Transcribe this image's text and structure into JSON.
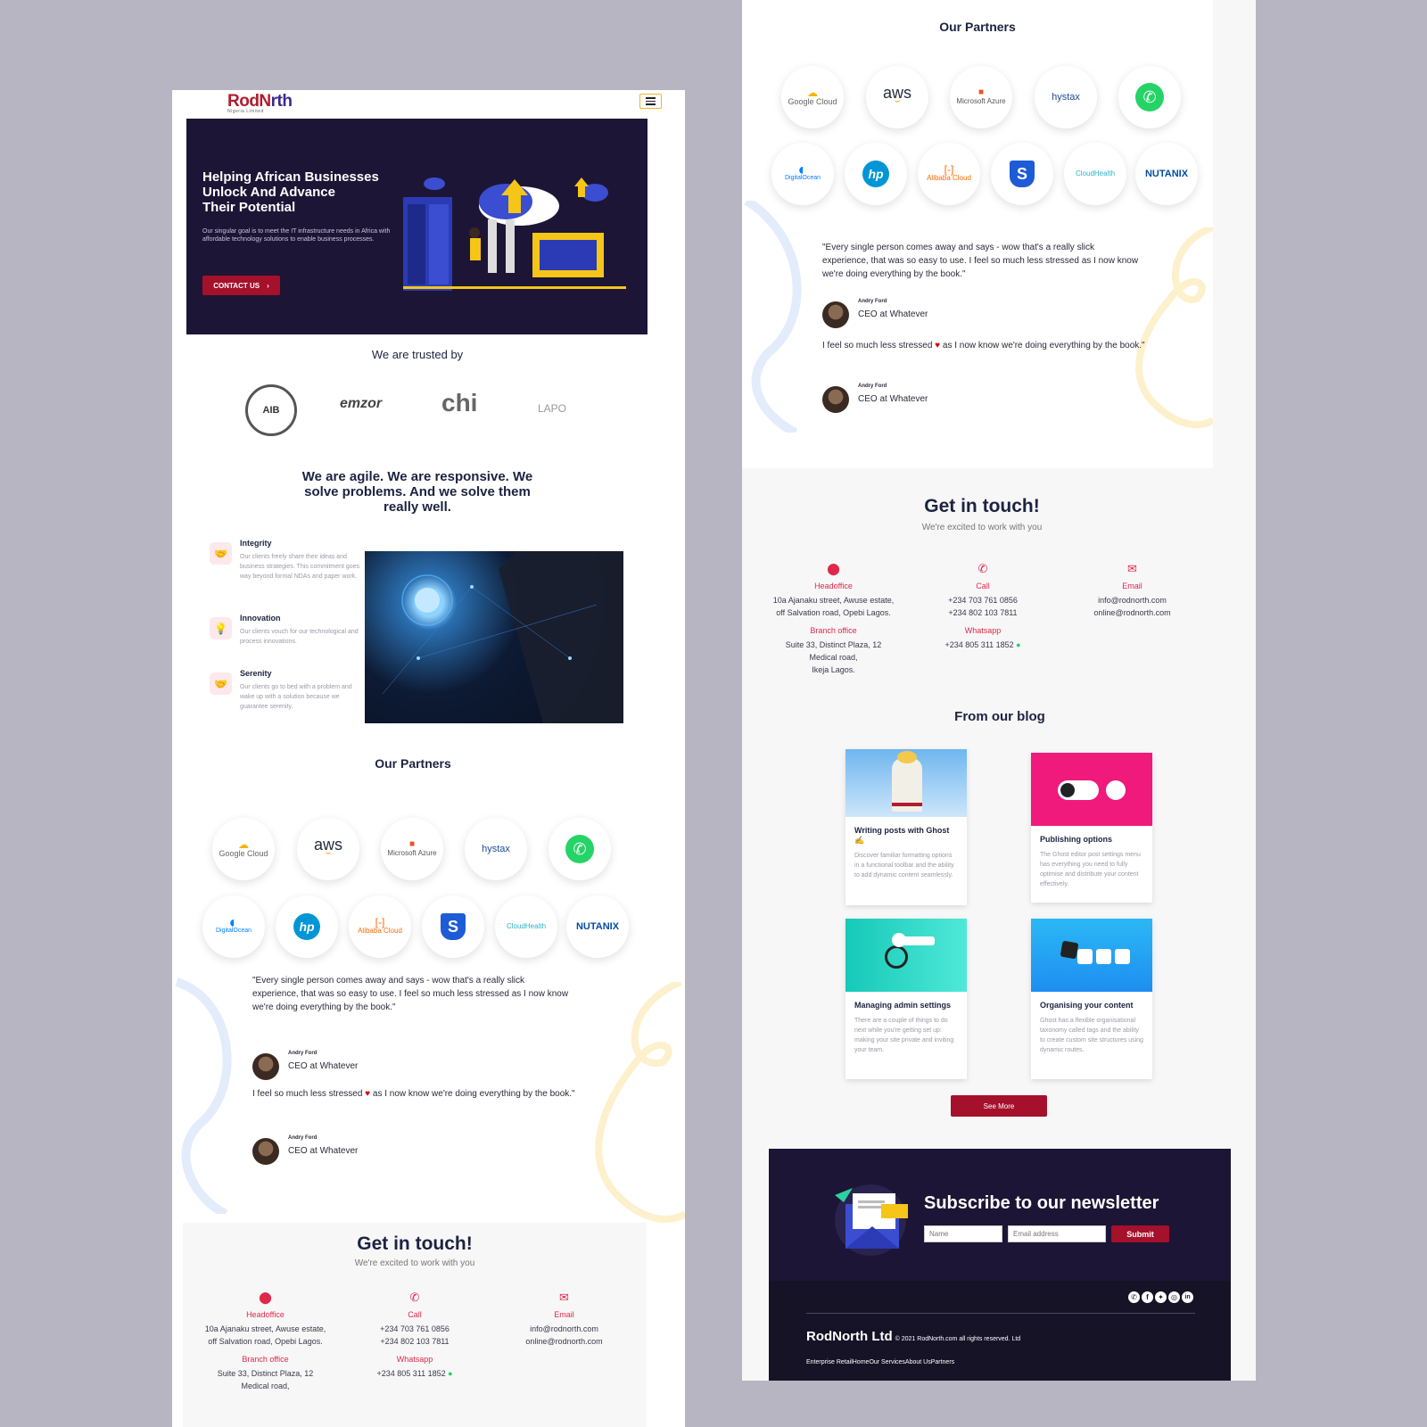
{
  "header": {
    "logo_main": "RodN",
    "logo_o": "◯",
    "logo_end": "rth",
    "logo_sub": "Nigeria Limited"
  },
  "hero": {
    "title_1": "Helping African Businesses",
    "title_2": "Unlock And Advance",
    "title_3": "Their Potential",
    "text": "Our singular goal is to meet the IT infrastructure needs in Africa with affordable technology solutions to enable business processes.",
    "cta": "CONTACT US",
    "cta_arrow": "›"
  },
  "trusted": {
    "title": "We are trusted by",
    "logos": [
      "AIB",
      "emzor",
      "chi",
      "LAPO"
    ]
  },
  "agile": {
    "line_1": "We are agile. We are responsive. We",
    "line_2": "solve problems. And we solve them",
    "line_3": "really well."
  },
  "features": [
    {
      "icon": "handshake-icon",
      "title": "Integrity",
      "text": "Our clients freely share their ideas and business strategies. This commitment goes way beyond formal NDAs and paper work."
    },
    {
      "icon": "lightbulb-icon",
      "title": "Innovation",
      "text": "Our clients vouch for our technological and process innovations."
    },
    {
      "icon": "handshake-icon",
      "title": "Serenity",
      "text": "Our clients go to bed with a problem and wake up with a solution because we guarantee serenity."
    }
  ],
  "partners": {
    "title": "Our Partners",
    "row1": [
      "Google Cloud",
      "aws",
      "Microsoft Azure",
      "hystax",
      "WhatsApp"
    ],
    "row2": [
      "DigitalOcean",
      "hp",
      "Alibaba Cloud",
      "S",
      "CloudHealth",
      "NUTANIX"
    ]
  },
  "testimonials": {
    "quote_1": "\"Every single person comes away and says - wow that's a really slick experience, that was so easy to use. I feel so much less stressed as I now know we're doing everything by the book.\"",
    "quote_2a": "I feel so much less stressed ",
    "quote_heart": "♥",
    "quote_2b": " as I now know we're doing everything by the book.\"",
    "author_name": "Andry Ford",
    "author_role": "CEO at Whatever"
  },
  "contact": {
    "title": "Get in touch!",
    "subtitle": "We're excited to work with you",
    "headoffice_label": "Headoffice",
    "headoffice_line1": "10a Ajanaku street, Awuse estate,",
    "headoffice_line2": "off Salvation road, Opebi Lagos.",
    "branch_label": "Branch office",
    "branch_line1": "Suite 33, Distinct Plaza, 12",
    "branch_line2": "Medical road,",
    "branch_line3": "Ikeja Lagos.",
    "call_label": "Call",
    "phone_1": "+234 703 761 0856",
    "phone_2": "+234 802 103 7811",
    "whatsapp_label": "Whatsapp",
    "whatsapp_number": "+234 805 311 1852",
    "email_label": "Email",
    "email_1": "info@rodnorth.com",
    "email_2": "online@rodnorth.com"
  },
  "blog": {
    "title": "From our blog",
    "posts": [
      {
        "title": "Writing posts with Ghost ✍️",
        "text": "Discover familiar formatting options in a functional toolbar and the ability to add dynamic content seamlessly."
      },
      {
        "title": "Publishing options",
        "text": "The Ghost editor post settings menu has everything you need to fully optimise and distribute your content effectively."
      },
      {
        "title": "Managing admin settings",
        "text": "There are a couple of things to do next while you're getting set up: making your site private and inviting your team."
      },
      {
        "title": "Organising your content",
        "text": "Ghost has a flexible organisational taxonomy called tags and the ability to create custom site structures using dynamic routes."
      }
    ],
    "see_more": "See More"
  },
  "newsletter": {
    "title": "Subscribe to our newsletter",
    "name_placeholder": "Name",
    "email_placeholder": "Email address",
    "submit": "Submit"
  },
  "footer": {
    "brand": "RodNorth Ltd",
    "copyright": "© 2021 RodNorth.com all rights reserved. Ltd",
    "links": [
      "Enterprise Retail",
      "Home",
      "Our Services",
      "About Us",
      "Partners"
    ],
    "social_icons": [
      "whatsapp-icon",
      "facebook-icon",
      "twitter-icon",
      "instagram-icon",
      "linkedin-icon"
    ]
  },
  "colors": {
    "brand_red": "#a5102a",
    "accent_red": "#e0284a",
    "hero_bg": "#1c1535",
    "footer_bg": "#161327"
  }
}
